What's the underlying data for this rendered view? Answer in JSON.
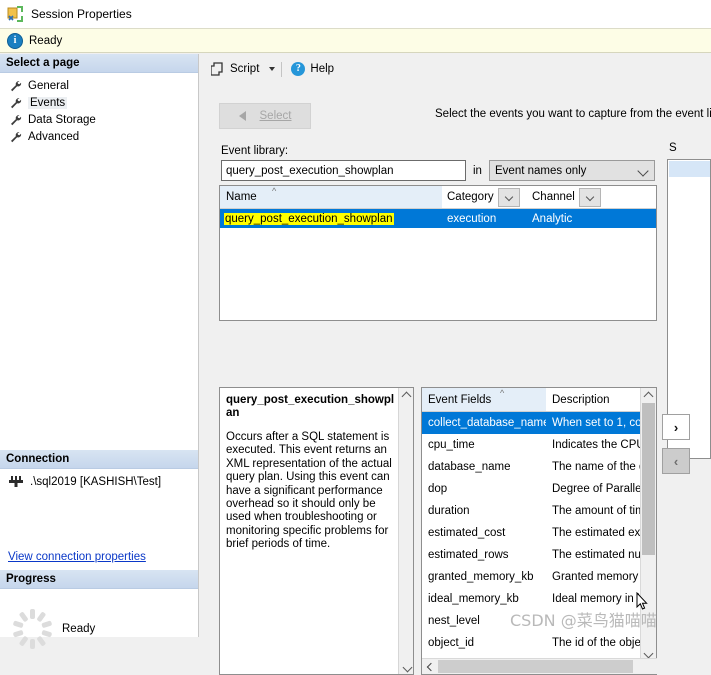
{
  "window": {
    "title": "Session Properties",
    "icon": "extended-events-icon"
  },
  "statusbar": {
    "icon": "info-icon",
    "text": "Ready"
  },
  "sidebar": {
    "header": "Select a page",
    "items": [
      {
        "label": "General",
        "icon": "wrench-icon",
        "selected": false
      },
      {
        "label": "Events",
        "icon": "wrench-icon",
        "selected": true
      },
      {
        "label": "Data Storage",
        "icon": "wrench-icon",
        "selected": false
      },
      {
        "label": "Advanced",
        "icon": "wrench-icon",
        "selected": false
      }
    ],
    "connection": {
      "header": "Connection",
      "icon": "server-connection-icon",
      "server": ".\\sql2019 [KASHISH\\Test]",
      "link": "View connection properties"
    },
    "progress": {
      "header": "Progress",
      "icon": "spinner-icon",
      "text": "Ready"
    }
  },
  "toolbar": {
    "script_label": "Script",
    "script_icon": "script-icon",
    "script_caret": "chevron-down-icon",
    "help_label": "Help",
    "help_icon": "help-icon"
  },
  "main": {
    "select_button": {
      "label": "Select",
      "icon": "left-triangle-icon",
      "enabled": false
    },
    "header_note": "Select the events you want to capture from the event librar",
    "event_library_label": "Event library:",
    "search_value": "query_post_execution_showplan",
    "in_word": "in",
    "filter_dropdown": {
      "value": "Event names only",
      "icon": "chevron-down-icon"
    },
    "grid": {
      "columns": [
        "Name",
        "Category",
        "Channel"
      ],
      "sort_indicator": "sort-ascending-icon",
      "rows": [
        {
          "name": "query_post_execution_showplan",
          "category": "execution",
          "channel": "Analytic",
          "selected": true
        }
      ]
    },
    "description_panel": {
      "title": "query_post_execution_showplan",
      "body": "Occurs after a SQL statement is executed. This event returns an XML representation of the actual query plan. Using this event can have a significant performance overhead so it should only be used when troubleshooting or monitoring specific problems for brief periods of time.",
      "scroll_up_icon": "scroll-up-arrow-icon",
      "scroll_down_icon": "scroll-down-arrow-icon"
    },
    "fields_panel": {
      "columns": [
        "Event Fields",
        "Description"
      ],
      "sort_indicator": "sort-ascending-icon",
      "rows": [
        {
          "field": "collect_database_name",
          "description": "When set to 1, co",
          "selected": true
        },
        {
          "field": "cpu_time",
          "description": "Indicates the CPU",
          "selected": false
        },
        {
          "field": "database_name",
          "description": "The name of the d",
          "selected": false
        },
        {
          "field": "dop",
          "description": "Degree of Parallel",
          "selected": false
        },
        {
          "field": "duration",
          "description": "The amount of tim",
          "selected": false
        },
        {
          "field": "estimated_cost",
          "description": "The estimated exe",
          "selected": false
        },
        {
          "field": "estimated_rows",
          "description": "The estimated nur",
          "selected": false
        },
        {
          "field": "granted_memory_kb",
          "description": "Granted memory i",
          "selected": false
        },
        {
          "field": "ideal_memory_kb",
          "description": "Ideal memory in K",
          "selected": false
        },
        {
          "field": "nest_level",
          "description": "",
          "selected": false
        },
        {
          "field": "object_id",
          "description": "The id of the obje",
          "selected": false
        }
      ],
      "scroll_up_icon": "scroll-up-arrow-icon",
      "scroll_down_icon": "scroll-down-arrow-icon",
      "scroll_left_icon": "scroll-left-arrow-icon"
    },
    "selected_panel_label": "S",
    "move_right_button": {
      "icon": "chevron-right-icon",
      "enabled": true
    },
    "move_left_button": {
      "icon": "chevron-left-icon",
      "enabled": false
    }
  },
  "watermark": "CSDN @菜鸟猫喵喵",
  "colors": {
    "selection_blue": "#0078d7",
    "highlight_yellow": "#ffff00",
    "header_blue": "#e4eef8",
    "link_blue": "#0a38c8",
    "info_bar": "#fdfde6"
  }
}
